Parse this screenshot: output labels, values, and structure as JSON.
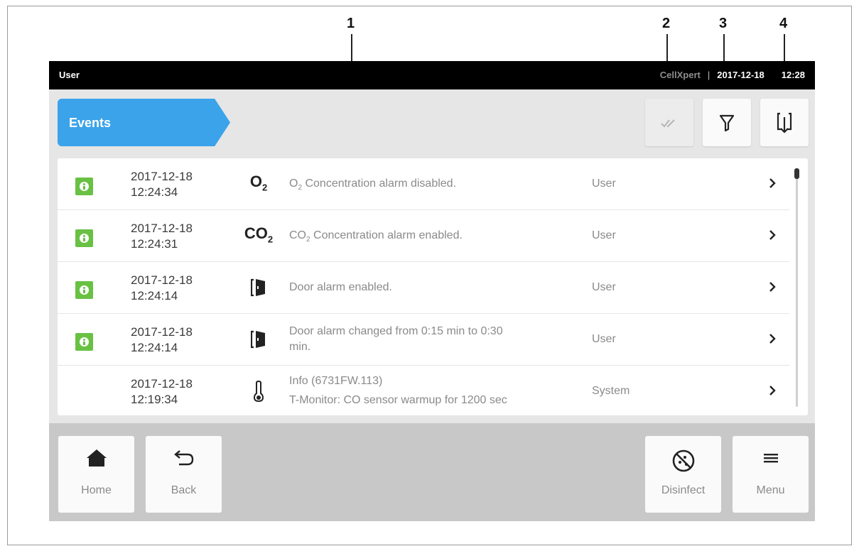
{
  "callouts": [
    "1",
    "2",
    "3",
    "4"
  ],
  "status_bar": {
    "user": "User",
    "brand": "CellXpert",
    "separator": "|",
    "date": "2017-12-18",
    "time": "12:28"
  },
  "header": {
    "tab_label": "Events",
    "icons": [
      "acknowledge-all-icon",
      "filter-icon",
      "export-icon"
    ]
  },
  "events": [
    {
      "badge": "info-icon",
      "date": "2017-12-18",
      "time": "12:24:34",
      "param_main": "O",
      "param_sub": "2",
      "desc_pre": "O",
      "desc_sub": "2",
      "desc_post": " Concentration alarm disabled.",
      "source": "User"
    },
    {
      "badge": "info-icon",
      "date": "2017-12-18",
      "time": "12:24:31",
      "param_main": "CO",
      "param_sub": "2",
      "desc_pre": "CO",
      "desc_sub": "2",
      "desc_post": " Concentration alarm enabled.",
      "source": "User"
    },
    {
      "badge": "info-icon",
      "date": "2017-12-18",
      "time": "12:24:14",
      "param_icon": "door-icon",
      "desc_line1": "Door alarm enabled.",
      "source": "User"
    },
    {
      "badge": "info-icon",
      "date": "2017-12-18",
      "time": "12:24:14",
      "param_icon": "door-icon",
      "desc_line1": "Door alarm changed from 0:15 min to 0:30",
      "desc_line2": "min.",
      "source": "User"
    },
    {
      "badge": "",
      "date": "2017-12-18",
      "time": "12:19:34",
      "param_icon": "thermometer-icon",
      "desc_line1": "Info (6731FW.113)",
      "desc_line2": "T-Monitor: CO sensor warmup for 1200 sec",
      "source": "System"
    }
  ],
  "nav": {
    "home_label": "Home",
    "back_label": "Back",
    "disinfect_label": "Disinfect",
    "menu_label": "Menu"
  },
  "colors": {
    "accent": "#3aa3ea",
    "info_badge": "#69c144",
    "callout_marker": "#e0457a"
  }
}
